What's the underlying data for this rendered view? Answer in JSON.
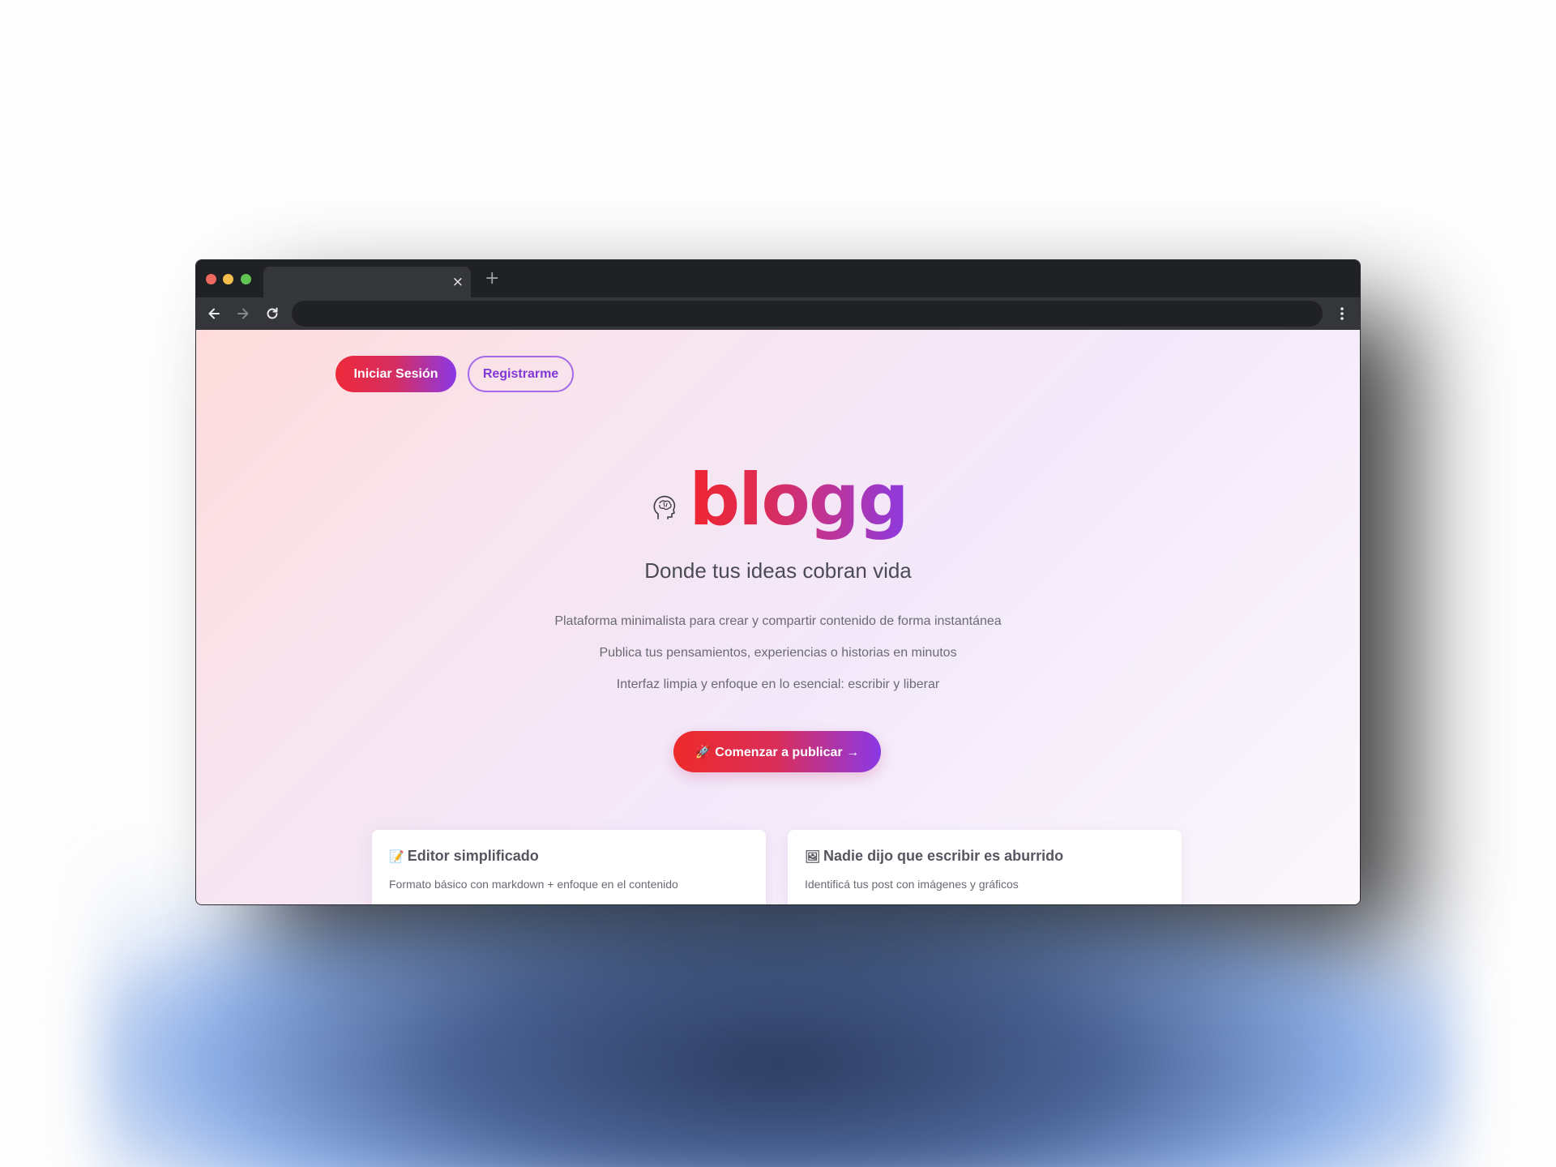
{
  "browser": {
    "tab_close": "×",
    "new_tab": "+"
  },
  "header": {
    "login_label": "Iniciar Sesión",
    "register_label": "Registrarme"
  },
  "hero": {
    "brand": "blogg",
    "tagline": "Donde tus ideas cobran vida",
    "descriptions": [
      "Plataforma minimalista para crear y compartir contenido de forma instantánea",
      "Publica tus pensamientos, experiencias o historias en minutos",
      "Interfaz limpia y enfoque en lo esencial: escribir y liberar"
    ],
    "cta_label": "🚀 Comenzar a publicar →"
  },
  "features": [
    {
      "icon": "📝",
      "title": "Editor simplificado",
      "description": "Formato básico con markdown + enfoque en el contenido"
    },
    {
      "icon": "🖼",
      "title": "Nadie dijo que escribir es aburrido",
      "description": "Identificá tus post con imágenes y gráficos"
    }
  ],
  "colors": {
    "accent_red": "#ee2a3a",
    "accent_purple": "#8a38e6",
    "browser_dark": "#202124",
    "browser_toolbar": "#35363a"
  },
  "icons": {
    "brand": "brain-head-icon",
    "back": "arrow-left-icon",
    "forward": "arrow-right-icon",
    "reload": "reload-icon",
    "menu": "kebab-menu-icon"
  }
}
